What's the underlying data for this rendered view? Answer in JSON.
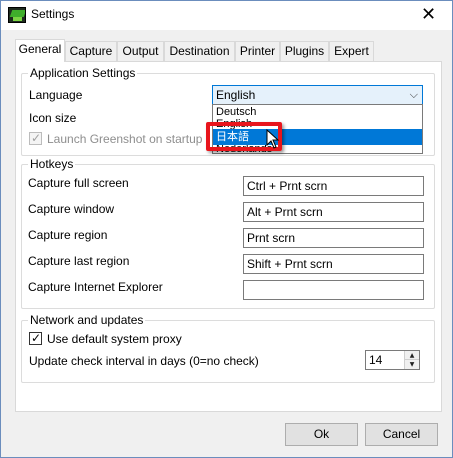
{
  "window": {
    "title": "Settings",
    "close_glyph": "✕"
  },
  "tabs": [
    {
      "label": "General",
      "active": true
    },
    {
      "label": "Capture",
      "active": false
    },
    {
      "label": "Output",
      "active": false
    },
    {
      "label": "Destination",
      "active": false
    },
    {
      "label": "Printer",
      "active": false
    },
    {
      "label": "Plugins",
      "active": false
    },
    {
      "label": "Expert",
      "active": false
    }
  ],
  "application_settings": {
    "title": "Application Settings",
    "language_label": "Language",
    "language_value": "English",
    "icon_size_label": "Icon size",
    "launch_label": "Launch Greenshot on startup",
    "launch_checked": true,
    "launch_enabled": false,
    "dropdown_options": [
      "Deutsch",
      "English",
      "日本語",
      "Nederlands"
    ],
    "dropdown_highlighted": "日本語"
  },
  "hotkeys": {
    "title": "Hotkeys",
    "rows": [
      {
        "label": "Capture full screen",
        "value": "Ctrl + Prnt scrn"
      },
      {
        "label": "Capture window",
        "value": "Alt + Prnt scrn"
      },
      {
        "label": "Capture region",
        "value": "Prnt scrn"
      },
      {
        "label": "Capture last region",
        "value": "Shift + Prnt scrn"
      },
      {
        "label": "Capture Internet Explorer",
        "value": ""
      }
    ]
  },
  "network": {
    "title": "Network and updates",
    "proxy_label": "Use default system proxy",
    "proxy_checked": true,
    "interval_label": "Update check interval in days (0=no check)",
    "interval_value": "14"
  },
  "buttons": {
    "ok": "Ok",
    "cancel": "Cancel"
  },
  "icons": {
    "app": "greenshot-app-icon",
    "close": "close-icon",
    "chevron": "chevron-down-icon",
    "cursor": "mouse-pointer-icon",
    "check": "checkmark-icon"
  },
  "colors": {
    "highlight_box": "#e8151c",
    "selection": "#0078d7"
  }
}
